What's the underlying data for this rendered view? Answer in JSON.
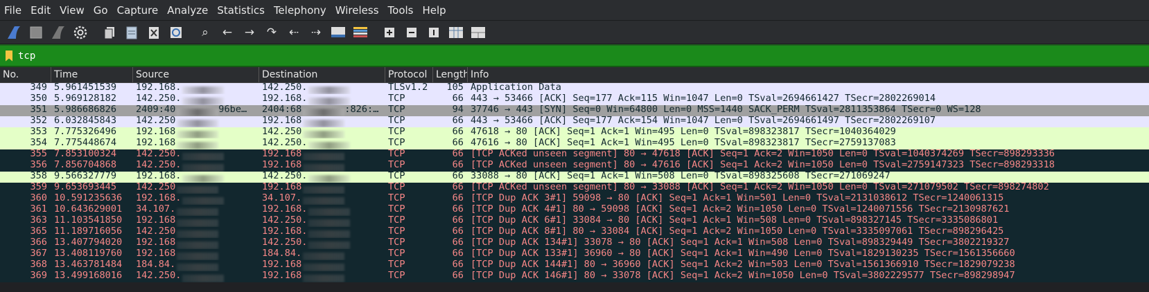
{
  "menu": [
    "File",
    "Edit",
    "View",
    "Go",
    "Capture",
    "Analyze",
    "Statistics",
    "Telephony",
    "Wireless",
    "Tools",
    "Help"
  ],
  "toolbar_icons": [
    "shark-fin-start-icon",
    "stop-square-icon",
    "restart-fin-icon",
    "capture-options-gear-icon",
    "open-file-icon",
    "save-file-icon",
    "close-file-icon",
    "reload-icon",
    "search-icon",
    "back-arrow-icon",
    "forward-arrow-icon",
    "go-to-packet-icon",
    "first-packet-icon",
    "last-packet-icon",
    "autoscroll-icon",
    "colorize-icon",
    "zoom-in-icon",
    "zoom-out-icon",
    "normal-size-icon",
    "resize-columns-icon",
    "layout-icon"
  ],
  "filter": {
    "value": "tcp"
  },
  "columns": [
    "No.",
    "Time",
    "Source",
    "Destination",
    "Protocol",
    "Length",
    "Info"
  ],
  "colors": {
    "lavender_bg": "#e7e6ff",
    "lavender_fg": "#12272e",
    "gray_bg": "#a0a0a0",
    "gray_fg": "#12272e",
    "green_bg": "#e4ffc7",
    "green_fg": "#12272e",
    "dark_bg": "#12272e",
    "dark_fg": "#f78787"
  },
  "packets": [
    {
      "no": "349",
      "time": "5.961451539",
      "src": "192.168.",
      "dst": "142.250.",
      "proto": "TLSv1.2",
      "len": "105",
      "info": "Application Data",
      "style": "lavender"
    },
    {
      "no": "350",
      "time": "5.969128182",
      "src": "142.250.",
      "dst": "192.168.",
      "proto": "TCP",
      "len": "66",
      "info": "443 → 53466 [ACK] Seq=177 Ack=115 Win=1047 Len=0 TSval=2694661427 TSecr=2802269014",
      "style": "lavender"
    },
    {
      "no": "351",
      "time": "5.986686826",
      "src": "2409:40",
      "dst": "2404:68",
      "proto": "TCP",
      "len": "94",
      "info": "37746 → 443 [SYN] Seq=0 Win=64800 Len=0 MSS=1440 SACK_PERM TSval=2811353864 TSecr=0 WS=128",
      "style": "gray",
      "src_tail": "96be…",
      "dst_tail": ":826:…"
    },
    {
      "no": "352",
      "time": "6.032845843",
      "src": "142.250",
      "dst": "192.168",
      "proto": "TCP",
      "len": "66",
      "info": "443 → 53466 [ACK] Seq=177 Ack=154 Win=1047 Len=0 TSval=2694661497 TSecr=2802269107",
      "style": "lavender"
    },
    {
      "no": "353",
      "time": "7.775326496",
      "src": "192.168",
      "dst": "142.250",
      "proto": "TCP",
      "len": "66",
      "info": "47618 → 80 [ACK] Seq=1 Ack=1 Win=495 Len=0 TSval=898323817 TSecr=1040364029",
      "style": "green"
    },
    {
      "no": "354",
      "time": "7.775448674",
      "src": "192.168",
      "dst": "142.250.",
      "proto": "TCP",
      "len": "66",
      "info": "47616 → 80 [ACK] Seq=1 Ack=1 Win=495 Len=0 TSval=898323817 TSecr=2759137083",
      "style": "green"
    },
    {
      "no": "355",
      "time": "7.853100324",
      "src": "142.250.",
      "dst": "192.168",
      "proto": "TCP",
      "len": "66",
      "info": "[TCP ACKed unseen segment] 80 → 47618 [ACK] Seq=1 Ack=2 Win=1050 Len=0 TSval=1040374269 TSecr=898293336",
      "style": "dark"
    },
    {
      "no": "356",
      "time": "7.856704868",
      "src": "142.250.",
      "dst": "192.168",
      "proto": "TCP",
      "len": "66",
      "info": "[TCP ACKed unseen segment] 80 → 47616 [ACK] Seq=1 Ack=2 Win=1050 Len=0 TSval=2759147323 TSecr=898293318",
      "style": "dark"
    },
    {
      "no": "358",
      "time": "9.566327779",
      "src": "192.168.",
      "dst": "142.250.",
      "proto": "TCP",
      "len": "66",
      "info": "33088 → 80 [ACK] Seq=1 Ack=1 Win=508 Len=0 TSval=898325608 TSecr=271069247",
      "style": "green"
    },
    {
      "no": "359",
      "time": "9.653693445",
      "src": "142.250",
      "dst": "192.168",
      "proto": "TCP",
      "len": "66",
      "info": "[TCP ACKed unseen segment] 80 → 33088 [ACK] Seq=1 Ack=2 Win=1050 Len=0 TSval=271079502 TSecr=898274802",
      "style": "dark"
    },
    {
      "no": "360",
      "time": "10.591235636",
      "src": "192.168.",
      "dst": "34.107.",
      "proto": "TCP",
      "len": "66",
      "info": "[TCP Dup ACK 3#1] 59098 → 80 [ACK] Seq=1 Ack=1 Win=501 Len=0 TSval=2131038612 TSecr=1240061315",
      "style": "dark"
    },
    {
      "no": "361",
      "time": "10.643629001",
      "src": "34.107.",
      "dst": "192.168.",
      "proto": "TCP",
      "len": "66",
      "info": "[TCP Dup ACK 4#1] 80 → 59098 [ACK] Seq=1 Ack=2 Win=1050 Len=0 TSval=1240071556 TSecr=2130987621",
      "style": "dark"
    },
    {
      "no": "363",
      "time": "11.103541850",
      "src": "192.168",
      "dst": "142.250.",
      "proto": "TCP",
      "len": "66",
      "info": "[TCP Dup ACK 6#1] 33084 → 80 [ACK] Seq=1 Ack=1 Win=508 Len=0 TSval=898327145 TSecr=3335086801",
      "style": "dark"
    },
    {
      "no": "365",
      "time": "11.189716056",
      "src": "142.250",
      "dst": "192.168.",
      "proto": "TCP",
      "len": "66",
      "info": "[TCP Dup ACK 8#1] 80 → 33084 [ACK] Seq=1 Ack=2 Win=1050 Len=0 TSval=3335097061 TSecr=898296425",
      "style": "dark"
    },
    {
      "no": "366",
      "time": "13.407794020",
      "src": "192.168",
      "dst": "142.250.",
      "proto": "TCP",
      "len": "66",
      "info": "[TCP Dup ACK 134#1] 33078 → 80 [ACK] Seq=1 Ack=1 Win=508 Len=0 TSval=898329449 TSecr=3802219327",
      "style": "dark"
    },
    {
      "no": "367",
      "time": "13.408119760",
      "src": "192.168",
      "dst": "184.84.",
      "proto": "TCP",
      "len": "66",
      "info": "[TCP Dup ACK 133#1] 36960 → 80 [ACK] Seq=1 Ack=1 Win=490 Len=0 TSval=1829130235 TSecr=1561356660",
      "style": "dark"
    },
    {
      "no": "368",
      "time": "13.463781484",
      "src": "184.84.",
      "dst": "192.168",
      "proto": "TCP",
      "len": "66",
      "info": "[TCP Dup ACK 144#1] 80 → 36960 [ACK] Seq=1 Ack=2 Win=503 Len=0 TSval=1561366910 TSecr=1829079238",
      "style": "dark"
    },
    {
      "no": "369",
      "time": "13.499168016",
      "src": "142.250.",
      "dst": "192.168",
      "proto": "TCP",
      "len": "66",
      "info": "[TCP Dup ACK 146#1] 80 → 33078 [ACK] Seq=1 Ack=2 Win=1050 Len=0 TSval=3802229577 TSecr=898298947",
      "style": "dark"
    }
  ]
}
